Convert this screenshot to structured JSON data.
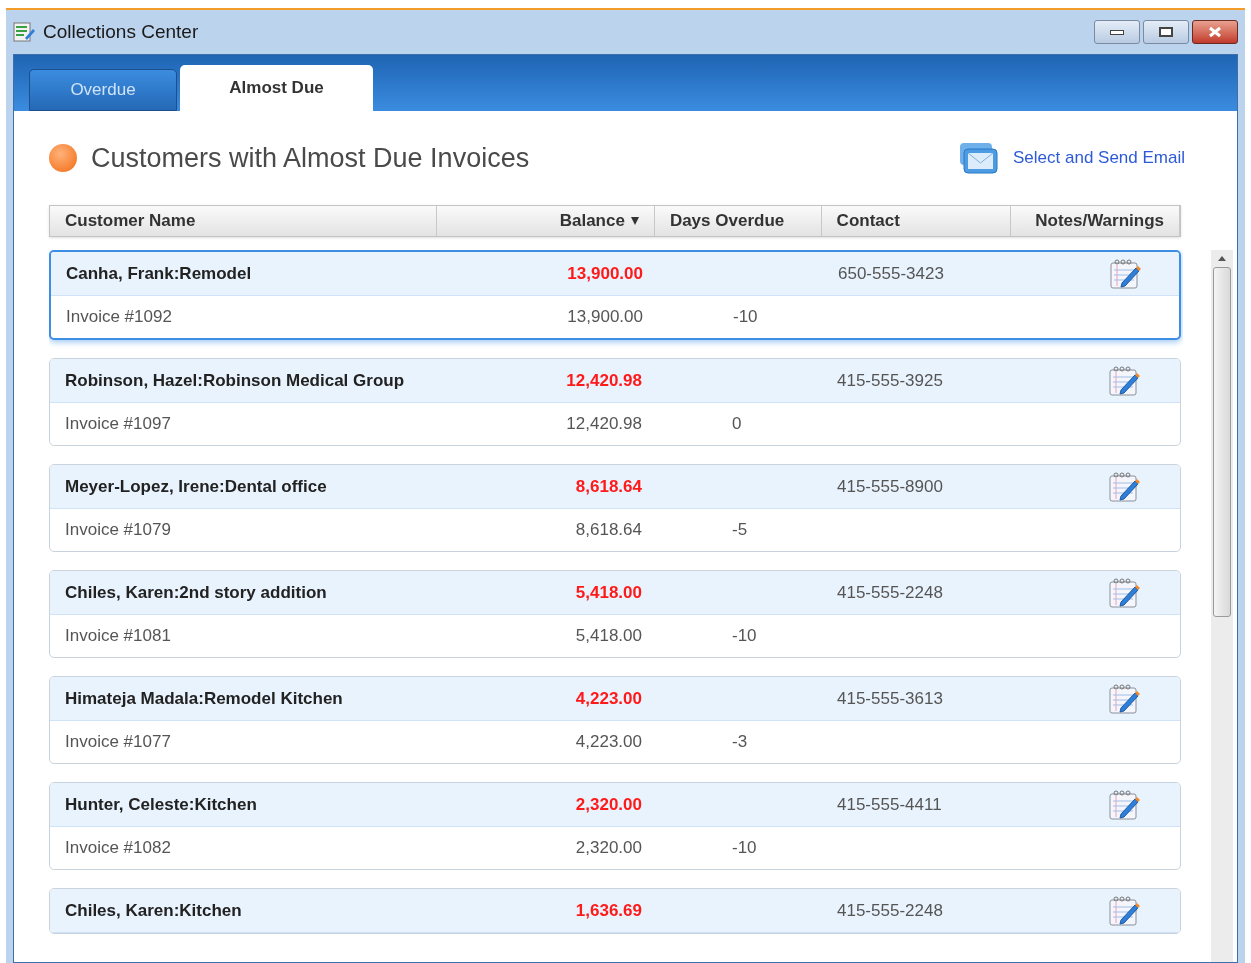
{
  "window": {
    "title": "Collections Center"
  },
  "tabs": [
    {
      "label": "Overdue",
      "selected": false
    },
    {
      "label": "Almost Due",
      "selected": true
    }
  ],
  "heading": "Customers with Almost Due Invoices",
  "email_link": "Select and Send Email",
  "table": {
    "columns": [
      {
        "label": "Customer Name",
        "sorted": false
      },
      {
        "label": "Balance",
        "sorted": true
      },
      {
        "label": "Days Overdue",
        "sorted": false
      },
      {
        "label": "Contact",
        "sorted": false
      },
      {
        "label": "Notes/Warnings",
        "sorted": false
      }
    ],
    "rows": [
      {
        "customer": "Canha, Frank:Remodel",
        "balance": "13,900.00",
        "contact": "650-555-3423",
        "selected": true,
        "invoice": {
          "label": "Invoice #1092",
          "amount": "13,900.00",
          "days": "-10"
        }
      },
      {
        "customer": "Robinson, Hazel:Robinson Medical Group",
        "balance": "12,420.98",
        "contact": "415-555-3925",
        "selected": false,
        "invoice": {
          "label": "Invoice #1097",
          "amount": "12,420.98",
          "days": "0"
        }
      },
      {
        "customer": "Meyer-Lopez, Irene:Dental office",
        "balance": "8,618.64",
        "contact": "415-555-8900",
        "selected": false,
        "invoice": {
          "label": "Invoice #1079",
          "amount": "8,618.64",
          "days": "-5"
        }
      },
      {
        "customer": "Chiles, Karen:2nd story addition",
        "balance": "5,418.00",
        "contact": "415-555-2248",
        "selected": false,
        "invoice": {
          "label": "Invoice #1081",
          "amount": "5,418.00",
          "days": "-10"
        }
      },
      {
        "customer": "Himateja Madala:Remodel Kitchen",
        "balance": "4,223.00",
        "contact": "415-555-3613",
        "selected": false,
        "invoice": {
          "label": "Invoice #1077",
          "amount": "4,223.00",
          "days": "-3"
        }
      },
      {
        "customer": "Hunter, Celeste:Kitchen",
        "balance": "2,320.00",
        "contact": "415-555-4411",
        "selected": false,
        "invoice": {
          "label": "Invoice #1082",
          "amount": "2,320.00",
          "days": "-10"
        }
      },
      {
        "customer": "Chiles, Karen:Kitchen",
        "balance": "1,636.69",
        "contact": "415-555-2248",
        "selected": false
      }
    ]
  }
}
